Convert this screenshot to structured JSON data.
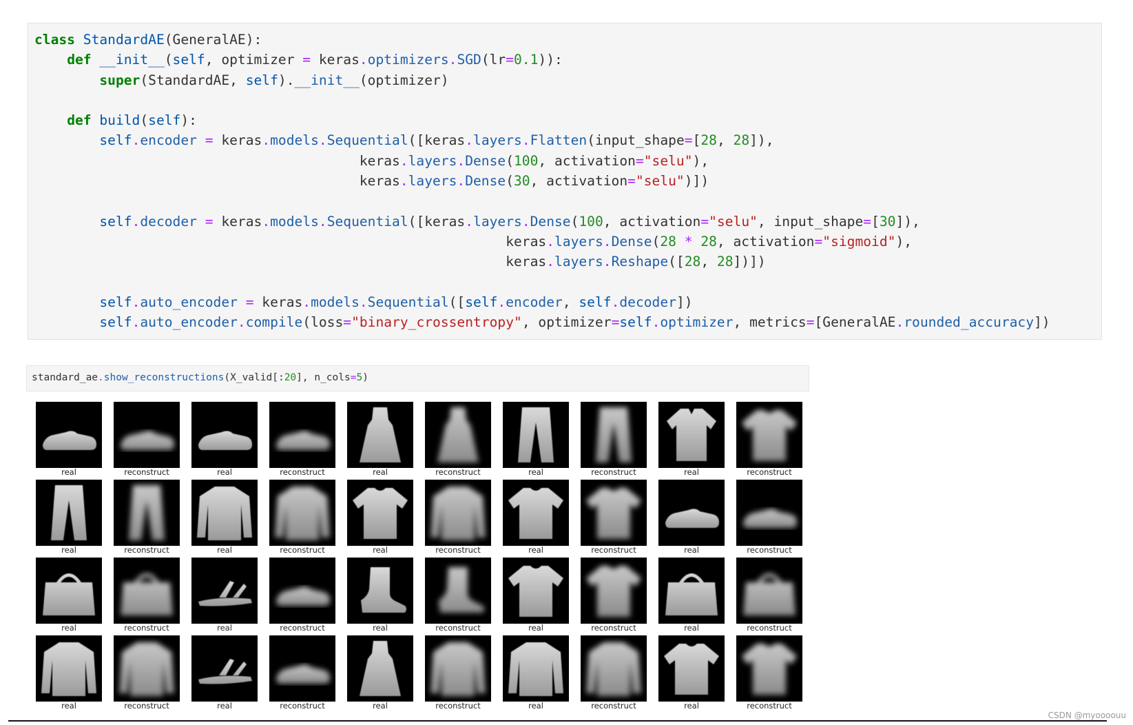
{
  "code_cell": {
    "lines": [
      [
        [
          "kw",
          "class"
        ],
        [
          "pl",
          " "
        ],
        [
          "def",
          "StandardAE"
        ],
        [
          "pl",
          "(GeneralAE):"
        ]
      ],
      [
        [
          "pl",
          "    "
        ],
        [
          "kw",
          "def"
        ],
        [
          "pl",
          " "
        ],
        [
          "def",
          "__init__"
        ],
        [
          "pl",
          "("
        ],
        [
          "nm",
          "self"
        ],
        [
          "pl",
          ", optimizer "
        ],
        [
          "op",
          "="
        ],
        [
          "pl",
          " keras"
        ],
        [
          "op",
          "."
        ],
        [
          "attr",
          "optimizers"
        ],
        [
          "op",
          "."
        ],
        [
          "attr",
          "SGD"
        ],
        [
          "pl",
          "(lr"
        ],
        [
          "op",
          "="
        ],
        [
          "num",
          "0.1"
        ],
        [
          "pl",
          ")):"
        ]
      ],
      [
        [
          "pl",
          "        "
        ],
        [
          "kw",
          "super"
        ],
        [
          "pl",
          "(StandardAE, "
        ],
        [
          "nm",
          "self"
        ],
        [
          "pl",
          ")."
        ],
        [
          "attr",
          "__init__"
        ],
        [
          "pl",
          "(optimizer)"
        ]
      ],
      [
        [
          "pl",
          ""
        ]
      ],
      [
        [
          "pl",
          "    "
        ],
        [
          "kw",
          "def"
        ],
        [
          "pl",
          " "
        ],
        [
          "def",
          "build"
        ],
        [
          "pl",
          "("
        ],
        [
          "nm",
          "self"
        ],
        [
          "pl",
          "):"
        ]
      ],
      [
        [
          "pl",
          "        "
        ],
        [
          "nm",
          "self"
        ],
        [
          "op",
          "."
        ],
        [
          "attr",
          "encoder"
        ],
        [
          "pl",
          " "
        ],
        [
          "op",
          "="
        ],
        [
          "pl",
          " keras"
        ],
        [
          "op",
          "."
        ],
        [
          "attr",
          "models"
        ],
        [
          "op",
          "."
        ],
        [
          "attr",
          "Sequential"
        ],
        [
          "pl",
          "([keras"
        ],
        [
          "op",
          "."
        ],
        [
          "attr",
          "layers"
        ],
        [
          "op",
          "."
        ],
        [
          "attr",
          "Flatten"
        ],
        [
          "pl",
          "(input_shape"
        ],
        [
          "op",
          "="
        ],
        [
          "pl",
          "["
        ],
        [
          "num",
          "28"
        ],
        [
          "pl",
          ", "
        ],
        [
          "num",
          "28"
        ],
        [
          "pl",
          "]),"
        ]
      ],
      [
        [
          "pl",
          "                                        keras"
        ],
        [
          "op",
          "."
        ],
        [
          "attr",
          "layers"
        ],
        [
          "op",
          "."
        ],
        [
          "attr",
          "Dense"
        ],
        [
          "pl",
          "("
        ],
        [
          "num",
          "100"
        ],
        [
          "pl",
          ", activation"
        ],
        [
          "op",
          "="
        ],
        [
          "str",
          "\"selu\""
        ],
        [
          "pl",
          "),"
        ]
      ],
      [
        [
          "pl",
          "                                        keras"
        ],
        [
          "op",
          "."
        ],
        [
          "attr",
          "layers"
        ],
        [
          "op",
          "."
        ],
        [
          "attr",
          "Dense"
        ],
        [
          "pl",
          "("
        ],
        [
          "num",
          "30"
        ],
        [
          "pl",
          ", activation"
        ],
        [
          "op",
          "="
        ],
        [
          "str",
          "\"selu\""
        ],
        [
          "pl",
          ")])"
        ]
      ],
      [
        [
          "pl",
          ""
        ]
      ],
      [
        [
          "pl",
          "        "
        ],
        [
          "nm",
          "self"
        ],
        [
          "op",
          "."
        ],
        [
          "attr",
          "decoder"
        ],
        [
          "pl",
          " "
        ],
        [
          "op",
          "="
        ],
        [
          "pl",
          " keras"
        ],
        [
          "op",
          "."
        ],
        [
          "attr",
          "models"
        ],
        [
          "op",
          "."
        ],
        [
          "attr",
          "Sequential"
        ],
        [
          "pl",
          "([keras"
        ],
        [
          "op",
          "."
        ],
        [
          "attr",
          "layers"
        ],
        [
          "op",
          "."
        ],
        [
          "attr",
          "Dense"
        ],
        [
          "pl",
          "("
        ],
        [
          "num",
          "100"
        ],
        [
          "pl",
          ", activation"
        ],
        [
          "op",
          "="
        ],
        [
          "str",
          "\"selu\""
        ],
        [
          "pl",
          ", input_shape"
        ],
        [
          "op",
          "="
        ],
        [
          "pl",
          "["
        ],
        [
          "num",
          "30"
        ],
        [
          "pl",
          "]),"
        ]
      ],
      [
        [
          "pl",
          "                                                          keras"
        ],
        [
          "op",
          "."
        ],
        [
          "attr",
          "layers"
        ],
        [
          "op",
          "."
        ],
        [
          "attr",
          "Dense"
        ],
        [
          "pl",
          "("
        ],
        [
          "num",
          "28"
        ],
        [
          "pl",
          " "
        ],
        [
          "op",
          "*"
        ],
        [
          "pl",
          " "
        ],
        [
          "num",
          "28"
        ],
        [
          "pl",
          ", activation"
        ],
        [
          "op",
          "="
        ],
        [
          "str",
          "\"sigmoid\""
        ],
        [
          "pl",
          "),"
        ]
      ],
      [
        [
          "pl",
          "                                                          keras"
        ],
        [
          "op",
          "."
        ],
        [
          "attr",
          "layers"
        ],
        [
          "op",
          "."
        ],
        [
          "attr",
          "Reshape"
        ],
        [
          "pl",
          "(["
        ],
        [
          "num",
          "28"
        ],
        [
          "pl",
          ", "
        ],
        [
          "num",
          "28"
        ],
        [
          "pl",
          "])])"
        ]
      ],
      [
        [
          "pl",
          ""
        ]
      ],
      [
        [
          "pl",
          "        "
        ],
        [
          "nm",
          "self"
        ],
        [
          "op",
          "."
        ],
        [
          "attr",
          "auto_encoder"
        ],
        [
          "pl",
          " "
        ],
        [
          "op",
          "="
        ],
        [
          "pl",
          " keras"
        ],
        [
          "op",
          "."
        ],
        [
          "attr",
          "models"
        ],
        [
          "op",
          "."
        ],
        [
          "attr",
          "Sequential"
        ],
        [
          "pl",
          "(["
        ],
        [
          "nm",
          "self"
        ],
        [
          "op",
          "."
        ],
        [
          "attr",
          "encoder"
        ],
        [
          "pl",
          ", "
        ],
        [
          "nm",
          "self"
        ],
        [
          "op",
          "."
        ],
        [
          "attr",
          "decoder"
        ],
        [
          "pl",
          "])"
        ]
      ],
      [
        [
          "pl",
          "        "
        ],
        [
          "nm",
          "self"
        ],
        [
          "op",
          "."
        ],
        [
          "attr",
          "auto_encoder"
        ],
        [
          "op",
          "."
        ],
        [
          "attr",
          "compile"
        ],
        [
          "pl",
          "(loss"
        ],
        [
          "op",
          "="
        ],
        [
          "str",
          "\"binary_crossentropy\""
        ],
        [
          "pl",
          ", optimizer"
        ],
        [
          "op",
          "="
        ],
        [
          "nm",
          "self"
        ],
        [
          "op",
          "."
        ],
        [
          "attr",
          "optimizer"
        ],
        [
          "pl",
          ", metrics"
        ],
        [
          "op",
          "="
        ],
        [
          "pl",
          "[GeneralAE"
        ],
        [
          "op",
          "."
        ],
        [
          "attr",
          "rounded_accuracy"
        ],
        [
          "pl",
          "])"
        ]
      ]
    ]
  },
  "cell2": {
    "tokens": [
      [
        "pl",
        "standard_ae"
      ],
      [
        "op",
        "."
      ],
      [
        "attr",
        "show_reconstructions"
      ],
      [
        "pl",
        "(X_valid[:"
      ],
      [
        "num",
        "20"
      ],
      [
        "pl",
        "], n_cols"
      ],
      [
        "op",
        "="
      ],
      [
        "num",
        "5"
      ],
      [
        "pl",
        ")"
      ]
    ]
  },
  "grid": {
    "tiles": [
      {
        "label": "real",
        "icon": "sneaker-image",
        "kind": "real"
      },
      {
        "label": "reconstruct",
        "icon": "sneaker-image",
        "kind": "recon"
      },
      {
        "label": "real",
        "icon": "sneaker-image",
        "kind": "real"
      },
      {
        "label": "reconstruct",
        "icon": "sneaker-image",
        "kind": "recon"
      },
      {
        "label": "real",
        "icon": "dress-image",
        "kind": "real"
      },
      {
        "label": "reconstruct",
        "icon": "dress-image",
        "kind": "recon"
      },
      {
        "label": "real",
        "icon": "trouser-image",
        "kind": "real"
      },
      {
        "label": "reconstruct",
        "icon": "trouser-image",
        "kind": "recon"
      },
      {
        "label": "real",
        "icon": "shirt-image",
        "kind": "real"
      },
      {
        "label": "reconstruct",
        "icon": "tshirt-image",
        "kind": "recon"
      },
      {
        "label": "real",
        "icon": "trouser-image",
        "kind": "real"
      },
      {
        "label": "reconstruct",
        "icon": "trouser-image",
        "kind": "recon"
      },
      {
        "label": "real",
        "icon": "pullover-image",
        "kind": "real"
      },
      {
        "label": "reconstruct",
        "icon": "pullover-image",
        "kind": "recon"
      },
      {
        "label": "real",
        "icon": "tshirt-image",
        "kind": "real"
      },
      {
        "label": "reconstruct",
        "icon": "pullover-image",
        "kind": "recon"
      },
      {
        "label": "real",
        "icon": "tshirt-image",
        "kind": "real"
      },
      {
        "label": "reconstruct",
        "icon": "tshirt-image",
        "kind": "recon"
      },
      {
        "label": "real",
        "icon": "sneaker-image",
        "kind": "real"
      },
      {
        "label": "reconstruct",
        "icon": "sneaker-image",
        "kind": "recon"
      },
      {
        "label": "real",
        "icon": "bag-image",
        "kind": "real"
      },
      {
        "label": "reconstruct",
        "icon": "bag-image",
        "kind": "recon"
      },
      {
        "label": "real",
        "icon": "sandal-image",
        "kind": "real"
      },
      {
        "label": "reconstruct",
        "icon": "sneaker-image",
        "kind": "recon"
      },
      {
        "label": "real",
        "icon": "boot-image",
        "kind": "real"
      },
      {
        "label": "reconstruct",
        "icon": "boot-image",
        "kind": "recon"
      },
      {
        "label": "real",
        "icon": "tshirt-image",
        "kind": "real"
      },
      {
        "label": "reconstruct",
        "icon": "tshirt-image",
        "kind": "recon"
      },
      {
        "label": "real",
        "icon": "bag-image",
        "kind": "real"
      },
      {
        "label": "reconstruct",
        "icon": "bag-image",
        "kind": "recon"
      },
      {
        "label": "real",
        "icon": "pullover-image",
        "kind": "real"
      },
      {
        "label": "reconstruct",
        "icon": "pullover-image",
        "kind": "recon"
      },
      {
        "label": "real",
        "icon": "sandal-image",
        "kind": "real"
      },
      {
        "label": "reconstruct",
        "icon": "sneaker-image",
        "kind": "recon"
      },
      {
        "label": "real",
        "icon": "dress-image",
        "kind": "real"
      },
      {
        "label": "reconstruct",
        "icon": "pullover-image",
        "kind": "recon"
      },
      {
        "label": "real",
        "icon": "pullover-image",
        "kind": "real"
      },
      {
        "label": "reconstruct",
        "icon": "pullover-image",
        "kind": "recon"
      },
      {
        "label": "real",
        "icon": "tshirt-image",
        "kind": "real"
      },
      {
        "label": "reconstruct",
        "icon": "tshirt-image",
        "kind": "recon"
      }
    ]
  },
  "footer": {
    "watermark": "CSDN @myoooouu"
  }
}
